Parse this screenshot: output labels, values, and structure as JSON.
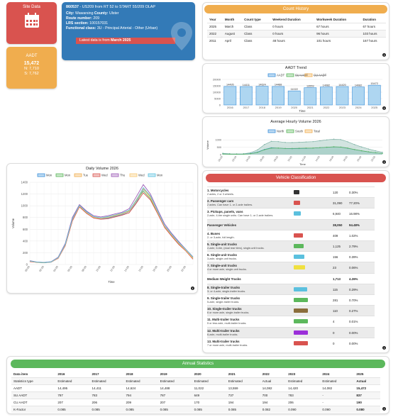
{
  "site_tile": {
    "title": "Site Data",
    "icon": "calendar-icon"
  },
  "aadt_tile": {
    "title": "AADT",
    "value": "15,472",
    "north": "N: 7,710",
    "south": "S: 7,762"
  },
  "info": {
    "station_id": "860537",
    "station_desc": " - US209 from RT 52 to START 55/209 OLAP",
    "city_label": "City:",
    "city": "Wawarsing",
    "county_label": "County:",
    "county": "Ulster",
    "route_label": "Route number:",
    "route": "209",
    "lrs_label": "LRS section:",
    "lrs": "100157031",
    "fc_label": "Functional class:",
    "fc": "3U - Principal Arterial - Other (Urban)",
    "notice_prefix": "Latest data is from ",
    "notice_date": "March 2025"
  },
  "count_history": {
    "title": "Count History",
    "headers": [
      "Year",
      "Month",
      "Count type",
      "Weekend Duration",
      "Workweek Duration",
      "Duration"
    ],
    "rows": [
      [
        "2025",
        "March",
        "Class",
        "0 hours",
        "67 hours",
        "67 hours"
      ],
      [
        "2022",
        "August",
        "Class",
        "0 hours",
        "96 hours",
        "103 hours"
      ],
      [
        "2011",
        "April",
        "Class",
        "48 hours",
        "101 hours",
        "167 hours"
      ]
    ]
  },
  "aadt_trend": {
    "title": "AADT Trend",
    "legend": [
      "AADT",
      "SU AADT",
      "CU AADT"
    ],
    "xlabel": "Time",
    "chart_data": {
      "type": "bar",
      "categories": [
        "2016",
        "2017",
        "2018",
        "2019",
        "2020",
        "2021",
        "2022",
        "2023",
        "2024",
        "2025"
      ],
      "values": [
        14495,
        14411,
        14624,
        14488,
        11022,
        13559,
        14082,
        14420,
        14082,
        15472
      ],
      "labels": [
        "14495",
        "14411",
        "14624",
        "14488",
        "11022",
        "13559",
        "14082",
        "14420",
        "14082",
        "15472"
      ],
      "yticks": [
        "0",
        "5000",
        "10000",
        "15000",
        "20000"
      ],
      "ylim": [
        0,
        20000
      ]
    }
  },
  "hourly": {
    "title": "Average Hourly Volume 2026",
    "legend": [
      "North",
      "South",
      "Total"
    ],
    "ylabel": "Volume",
    "xlabel": "Time",
    "yticks": [
      "0",
      "500",
      "1000"
    ],
    "xticks": [
      "00:00",
      "02:00",
      "04:00",
      "06:00",
      "08:00",
      "10:00",
      "12:00",
      "14:00",
      "16:00",
      "18:00",
      "20:00",
      "22:00"
    ],
    "chart_data": {
      "type": "area",
      "x": [
        0,
        1,
        2,
        3,
        4,
        5,
        6,
        7,
        8,
        9,
        10,
        11,
        12,
        13,
        14,
        15,
        16,
        17,
        18,
        19,
        20,
        21,
        22,
        23
      ],
      "series": [
        {
          "name": "Total",
          "values": [
            90,
            60,
            50,
            60,
            130,
            320,
            680,
            900,
            880,
            830,
            820,
            840,
            860,
            880,
            940,
            1000,
            1050,
            1020,
            870,
            680,
            520,
            380,
            260,
            160
          ]
        },
        {
          "name": "North",
          "values": [
            45,
            30,
            25,
            30,
            70,
            170,
            350,
            460,
            440,
            410,
            400,
            410,
            420,
            440,
            470,
            500,
            520,
            510,
            430,
            340,
            260,
            190,
            130,
            80
          ]
        },
        {
          "name": "South",
          "values": [
            45,
            30,
            25,
            30,
            60,
            150,
            330,
            440,
            440,
            420,
            420,
            430,
            440,
            440,
            470,
            500,
            530,
            510,
            440,
            340,
            260,
            190,
            130,
            80
          ]
        }
      ],
      "ylim": [
        0,
        1300
      ]
    }
  },
  "daily": {
    "title": "Daily Volume 2026",
    "legend": [
      "Mon",
      "Mon",
      "Tue",
      "Wed",
      "Thu",
      "Wed",
      "Mon"
    ],
    "ylabel": "Volume",
    "xlabel": "Time",
    "yticks": [
      "0",
      "200",
      "400",
      "600",
      "800",
      "1000",
      "1200",
      "1400"
    ],
    "xticks": [
      "00:00",
      "01:00",
      "02:00",
      "03:00",
      "04:00",
      "05:00",
      "06:00",
      "07:00",
      "08:00",
      "09:00",
      "10:00",
      "11:00",
      "12:00",
      "13:00",
      "14:00",
      "15:00",
      "16:00",
      "17:00",
      "18:00",
      "19:00",
      "20:00",
      "21:00",
      "22:00",
      "23:00"
    ],
    "chart_data": {
      "type": "line",
      "x": [
        0,
        1,
        2,
        3,
        4,
        5,
        6,
        7,
        8,
        9,
        10,
        11,
        12,
        13,
        14,
        15,
        16,
        17,
        18,
        19,
        20,
        21,
        22,
        23
      ],
      "series": [
        {
          "name": "Mon",
          "values": [
            60,
            40,
            30,
            40,
            110,
            330,
            760,
            1000,
            900,
            800,
            780,
            790,
            820,
            850,
            900,
            1050,
            1280,
            1150,
            900,
            650,
            500,
            360,
            240,
            110
          ]
        },
        {
          "name": "Mon",
          "values": [
            55,
            35,
            30,
            45,
            120,
            350,
            780,
            990,
            880,
            810,
            790,
            800,
            830,
            860,
            920,
            1080,
            1250,
            1120,
            880,
            640,
            490,
            350,
            230,
            100
          ]
        },
        {
          "name": "Tue",
          "values": [
            60,
            40,
            35,
            45,
            115,
            340,
            770,
            1010,
            890,
            800,
            790,
            810,
            840,
            870,
            910,
            1100,
            1300,
            1160,
            910,
            660,
            510,
            370,
            250,
            120
          ]
        },
        {
          "name": "Wed",
          "values": [
            50,
            38,
            32,
            42,
            105,
            320,
            740,
            980,
            870,
            790,
            770,
            780,
            810,
            840,
            880,
            1040,
            1220,
            1100,
            870,
            630,
            480,
            340,
            230,
            90
          ]
        },
        {
          "name": "Thu",
          "values": [
            65,
            42,
            36,
            48,
            125,
            360,
            800,
            1020,
            910,
            830,
            810,
            830,
            860,
            890,
            950,
            1150,
            1360,
            1200,
            940,
            690,
            530,
            390,
            260,
            130
          ]
        },
        {
          "name": "Wed",
          "values": [
            58,
            39,
            33,
            44,
            112,
            335,
            765,
            995,
            885,
            805,
            785,
            800,
            830,
            860,
            905,
            1070,
            1290,
            1140,
            895,
            650,
            500,
            360,
            240,
            105
          ]
        },
        {
          "name": "Mon",
          "values": [
            62,
            41,
            34,
            46,
            118,
            345,
            775,
            1005,
            895,
            815,
            795,
            815,
            845,
            875,
            925,
            1090,
            1310,
            1170,
            915,
            665,
            515,
            375,
            255,
            125
          ]
        }
      ],
      "ylim": [
        0,
        1400
      ]
    }
  },
  "vehicle_class": {
    "title": "Vehicle Classification",
    "rows": [
      {
        "name": "1. Motorcycles",
        "desc": "2 axles, 2 or 3 wheels.",
        "count": "120",
        "pct": "0.30%",
        "color": "#333333",
        "shade": false
      },
      {
        "name": "2. Passenger cars",
        "desc": "2 axles. Can have 1- or 2-axle trailers.",
        "count": "31,090",
        "pct": "77.20%",
        "color": "#d9534f",
        "shade": true
      },
      {
        "name": "3. Pickups, panels, vans",
        "desc": "2-axle, 4-tire single units. Can have 1- or 2-axle trailers.",
        "count": "6,940",
        "pct": "16.98%",
        "color": "#5bc0de",
        "shade": false
      },
      {
        "name": "Passenger Vehicles",
        "desc": "",
        "count": "38,050",
        "pct": "94.48%",
        "color": "",
        "shade": true
      },
      {
        "name": "4. Buses",
        "desc": "2- or 3-axle, full length.",
        "count": "409",
        "pct": "1.02%",
        "color": "#d9534f",
        "shade": false
      },
      {
        "name": "5. Single-unit trucks",
        "desc": "2-axle, 6-tire, (dual rear tires), single-unit trucks.",
        "count": "1,125",
        "pct": "2.79%",
        "color": "#5cb85c",
        "shade": true
      },
      {
        "name": "6. Single-unit trucks",
        "desc": "3-axle, single-unit trucks.",
        "count": "156",
        "pct": "0.39%",
        "color": "#5bc0de",
        "shade": false
      },
      {
        "name": "7. Single-unit trucks",
        "desc": "4 or more axle, single-unit trucks.",
        "count": "23",
        "pct": "0.06%",
        "color": "#f0e040",
        "shade": true
      },
      {
        "name": "Medium Weight Trucks",
        "desc": "",
        "count": "1,713",
        "pct": "4.26%",
        "color": "",
        "shade": false
      },
      {
        "name": "8. Single-trailer trucks",
        "desc": "3- or 4-axle, single-trailer trucks.",
        "count": "115",
        "pct": "0.29%",
        "color": "#5bc0de",
        "shade": true
      },
      {
        "name": "9. Single-trailer trucks",
        "desc": "5-axle, single-trailer trucks.",
        "count": "281",
        "pct": "0.70%",
        "color": "#5cb85c",
        "shade": false
      },
      {
        "name": "10. Single-trailer trucks",
        "desc": "6 or more axle, single-trailer trucks.",
        "count": "110",
        "pct": "0.27%",
        "color": "#8a6d3b",
        "shade": true
      },
      {
        "name": "11. Multi-trailer trucks",
        "desc": "5 or less axle, multi-trailer trucks.",
        "count": "4",
        "pct": "0.01%",
        "color": "#5cb85c",
        "shade": false
      },
      {
        "name": "12. Multi-trailer trucks",
        "desc": "6-axle, multi-trailer trucks.",
        "count": "0",
        "pct": "0.00%",
        "color": "#9b30d9",
        "shade": true
      },
      {
        "name": "13. Multi-trailer trucks",
        "desc": "7 or more axle, multi-trailer trucks.",
        "count": "0",
        "pct": "0.00%",
        "color": "#d9534f",
        "shade": false
      }
    ]
  },
  "annual": {
    "title": "Annual Statistics",
    "headers": [
      "Data item",
      "2016",
      "2017",
      "2018",
      "2019",
      "2020",
      "2021",
      "2022",
      "2023",
      "2024",
      "2025"
    ],
    "rows": [
      [
        "Statistics type",
        "Estimated",
        "Estimated",
        "Estimated",
        "Estimated",
        "Estimated",
        "Estimated",
        "Actual",
        "Estimated",
        "Estimated",
        "Actual"
      ],
      [
        "AADT",
        "14,495",
        "14,411",
        "14,624",
        "14,488",
        "11,022",
        "13,559",
        "14,082",
        "14,420",
        "14,082",
        "15,472"
      ],
      [
        "SU AADT",
        "787",
        "783",
        "794",
        "787",
        "649",
        "737",
        "700",
        "783",
        "-",
        "837"
      ],
      [
        "CU AADT",
        "207",
        "206",
        "209",
        "207",
        "170",
        "194",
        "194",
        "206",
        "-",
        "190"
      ],
      [
        "K-Factor",
        "0.085",
        "0.085",
        "0.085",
        "0.085",
        "0.085",
        "0.085",
        "0.082",
        "0.090",
        "0.090",
        "0.080"
      ]
    ]
  },
  "colors": {
    "red": "#d9534f",
    "orange": "#f0ad4e",
    "blue": "#337ab7",
    "green": "#5cb85c",
    "bar": "#aed6f1"
  }
}
